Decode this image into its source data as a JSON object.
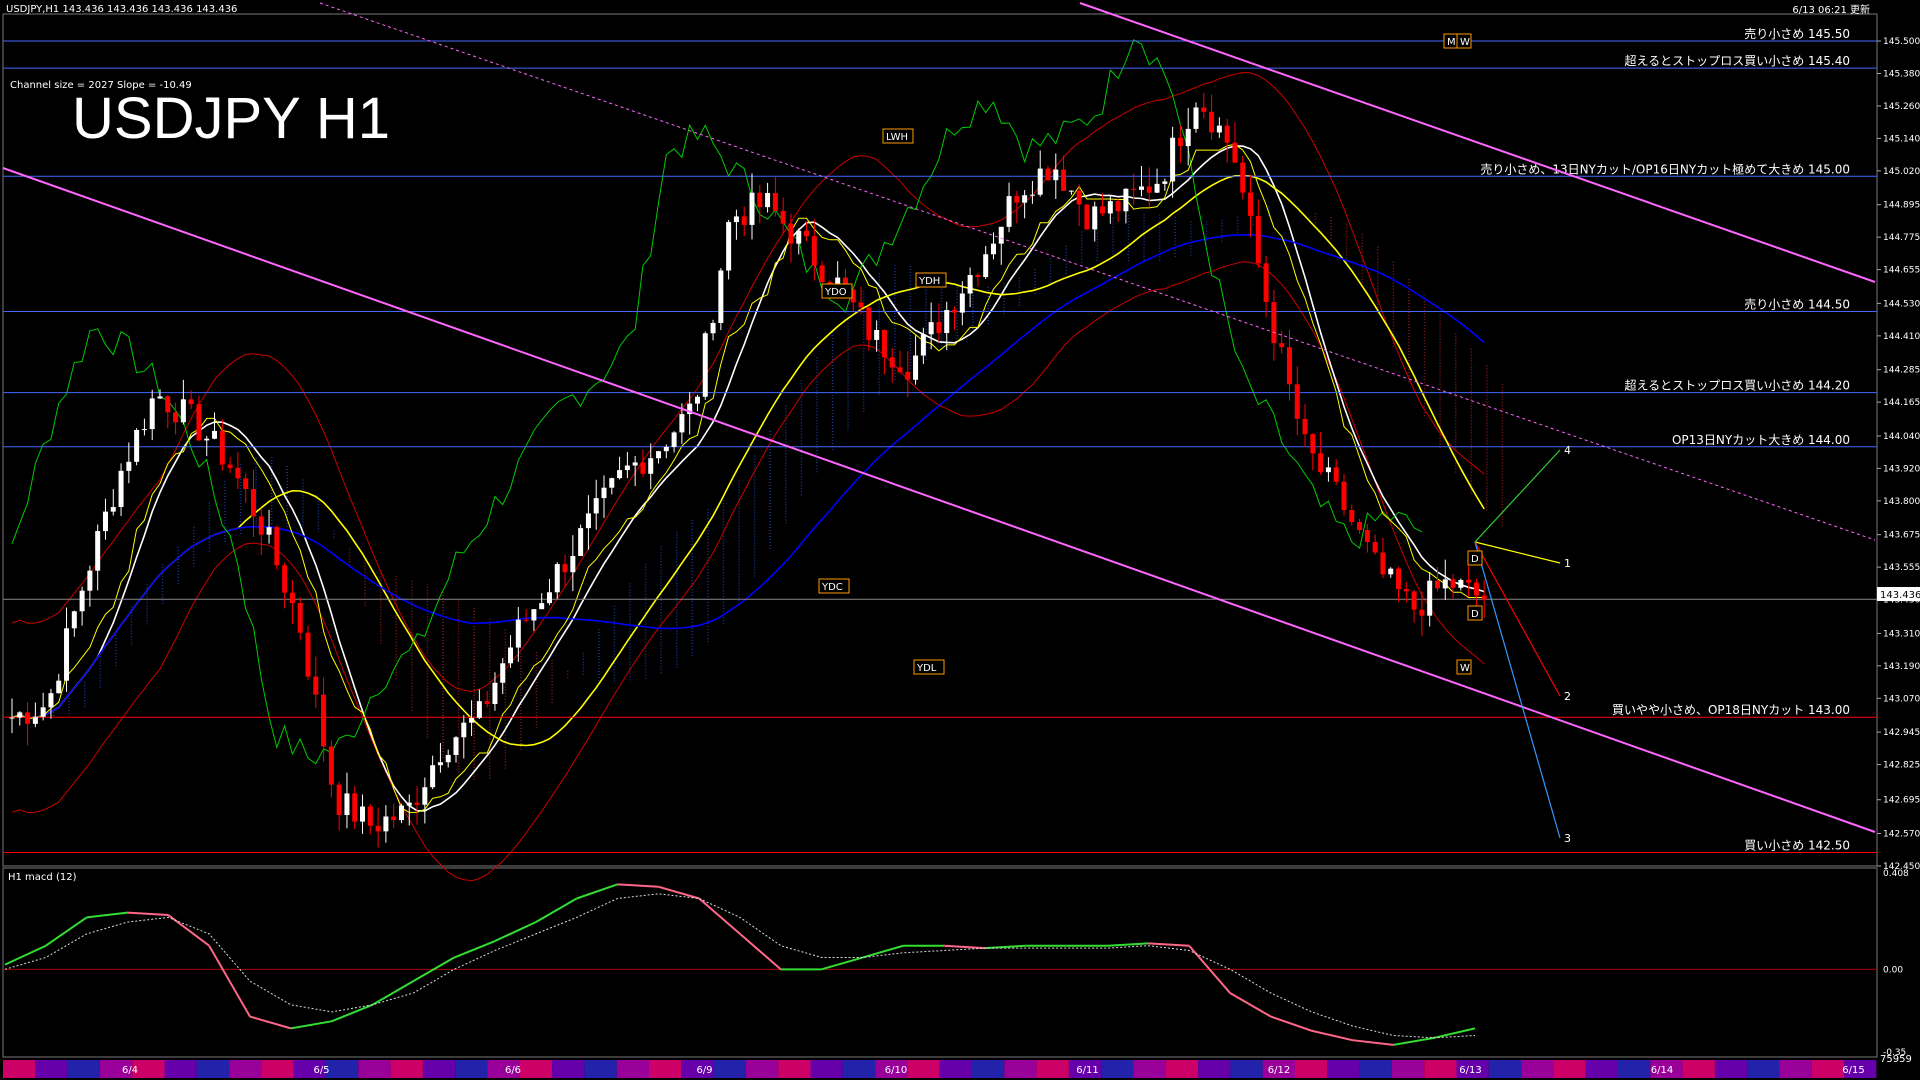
{
  "window": {
    "header": "USDJPY,H1  143.436 143.436 143.436 143.436",
    "timestamp": "6/13 06:21 更新"
  },
  "overlay": {
    "title": "USDJPY H1",
    "channel_info": "Channel size = 2027 Slope = -10.49"
  },
  "colors": {
    "background": "#000000",
    "bull_candle": "#ffffff",
    "bear_candle": "#ff0000",
    "ma_fast": "#ffffff",
    "ma_mid": "#ffff00",
    "ma_slow": "#0000ff",
    "channel": "#ff66ff",
    "level_blue": "#4466ff",
    "level_red": "#ff0000",
    "chikou": "#00cc00",
    "tenkan": "#ffff00",
    "bollinger": "#cc0000",
    "macd_up": "#33dd33",
    "macd_down": "#ff6688",
    "orange_label": "#ff9900"
  },
  "chart_data": [
    {
      "type": "candlestick",
      "symbol": "USDJPY",
      "timeframe": "H1",
      "title": "USDJPY H1",
      "ylim": [
        142.45,
        145.6
      ],
      "last_price": "143.436",
      "y_ticks": [
        "145.500",
        "145.380",
        "145.260",
        "145.140",
        "145.020",
        "144.895",
        "144.775",
        "144.655",
        "144.530",
        "144.410",
        "144.285",
        "144.165",
        "144.040",
        "143.920",
        "143.800",
        "143.675",
        "143.555",
        "143.436",
        "143.310",
        "143.190",
        "143.070",
        "142.945",
        "142.825",
        "142.695",
        "142.570",
        "142.450"
      ],
      "x_labels": [
        "6/4",
        "6/5",
        "6/6",
        "6/9",
        "6/10",
        "6/11",
        "6/12",
        "6/13",
        "6/14",
        "6/15"
      ],
      "close_path": [
        143.0,
        143.05,
        143.5,
        143.9,
        144.2,
        144.1,
        143.95,
        143.7,
        143.35,
        142.7,
        142.6,
        142.65,
        142.9,
        143.0,
        143.3,
        143.5,
        143.7,
        143.9,
        144.0,
        144.15,
        144.85,
        144.9,
        144.75,
        144.6,
        144.4,
        144.3,
        144.5,
        144.7,
        144.95,
        145.05,
        144.85,
        144.9,
        145.0,
        145.3,
        145.1,
        144.5,
        144.0,
        143.8,
        143.55,
        143.4,
        143.5,
        143.436
      ],
      "levels": [
        {
          "label": "売り小さめ 145.50",
          "price": 145.5,
          "color": "#4466ff"
        },
        {
          "label": "超えるとストップロス買い小さめ 145.40",
          "price": 145.4,
          "color": "#4466ff"
        },
        {
          "label": "売り小さめ、13日NYカット/OP16日NYカット極めて大きめ 145.00",
          "price": 145.0,
          "color": "#4466ff"
        },
        {
          "label": "売り小さめ 144.50",
          "price": 144.5,
          "color": "#4466ff"
        },
        {
          "label": "超えるとストップロス買い小さめ 144.20",
          "price": 144.2,
          "color": "#4466ff"
        },
        {
          "label": "OP13日NYカット大きめ 144.00",
          "price": 144.0,
          "color": "#4466ff"
        },
        {
          "label": "買いやや小さめ、OP18日NYカット 143.00",
          "price": 143.0,
          "color": "#ff0000"
        },
        {
          "label": "買い小さめ 142.50",
          "price": 142.5,
          "color": "#ff0000"
        }
      ],
      "markers": [
        "LWH",
        "YDO",
        "YDH",
        "YDC",
        "YDL",
        "M",
        "W",
        "D",
        "D",
        "W"
      ],
      "projections": [
        "1",
        "2",
        "3",
        "4"
      ]
    },
    {
      "type": "line",
      "title": "H1  macd (12)",
      "ylim": [
        -0.35,
        0.408
      ],
      "y_ticks": [
        "0.408",
        "0.00",
        "-0.35"
      ],
      "series": [
        {
          "values": [
            0.02,
            0.1,
            0.22,
            0.24,
            0.23,
            0.1,
            -0.2,
            -0.25,
            -0.22,
            -0.15,
            -0.05,
            0.05,
            0.12,
            0.2,
            0.3,
            0.36,
            0.35,
            0.3,
            0.15,
            0.0,
            0.0,
            0.05,
            0.1,
            0.1,
            0.09,
            0.1,
            0.1,
            0.1,
            0.11,
            0.1,
            -0.1,
            -0.2,
            -0.26,
            -0.3,
            -0.32,
            -0.29,
            -0.25
          ]
        },
        {
          "values": [
            0.0,
            0.05,
            0.15,
            0.2,
            0.22,
            0.15,
            -0.05,
            -0.15,
            -0.18,
            -0.15,
            -0.1,
            0.0,
            0.08,
            0.15,
            0.22,
            0.3,
            0.32,
            0.3,
            0.22,
            0.1,
            0.05,
            0.05,
            0.07,
            0.08,
            0.09,
            0.09,
            0.09,
            0.09,
            0.1,
            0.08,
            0.0,
            -0.1,
            -0.18,
            -0.24,
            -0.28,
            -0.29,
            -0.28
          ]
        }
      ]
    }
  ],
  "bottom_bar": {
    "right_number": "75959"
  }
}
